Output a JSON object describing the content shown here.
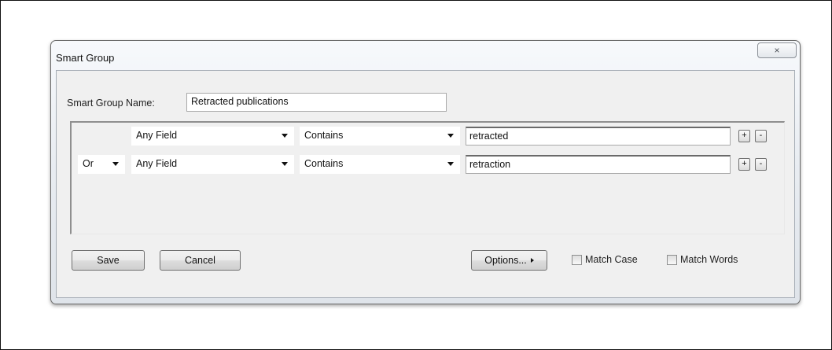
{
  "dialog": {
    "title": "Smart Group",
    "close_icon": "×"
  },
  "name": {
    "label": "Smart Group Name:",
    "value": "Retracted publications"
  },
  "criteria": [
    {
      "connector": "",
      "field": "Any Field",
      "operator": "Contains",
      "value": "retracted",
      "add_label": "+",
      "remove_label": "-"
    },
    {
      "connector": "Or",
      "field": "Any Field",
      "operator": "Contains",
      "value": "retraction",
      "add_label": "+",
      "remove_label": "-"
    }
  ],
  "footer": {
    "save_label": "Save",
    "cancel_label": "Cancel",
    "options_label": "Options...",
    "match_case_label": "Match Case",
    "match_case_checked": false,
    "match_words_label": "Match Words",
    "match_words_checked": false
  },
  "icons": {
    "close": "close-icon",
    "dropdown": "chevron-down-icon",
    "options": "triangle-right-icon"
  },
  "colors": {
    "dialog_border": "#6b6b6b",
    "client_bg": "#f0f0f0"
  }
}
